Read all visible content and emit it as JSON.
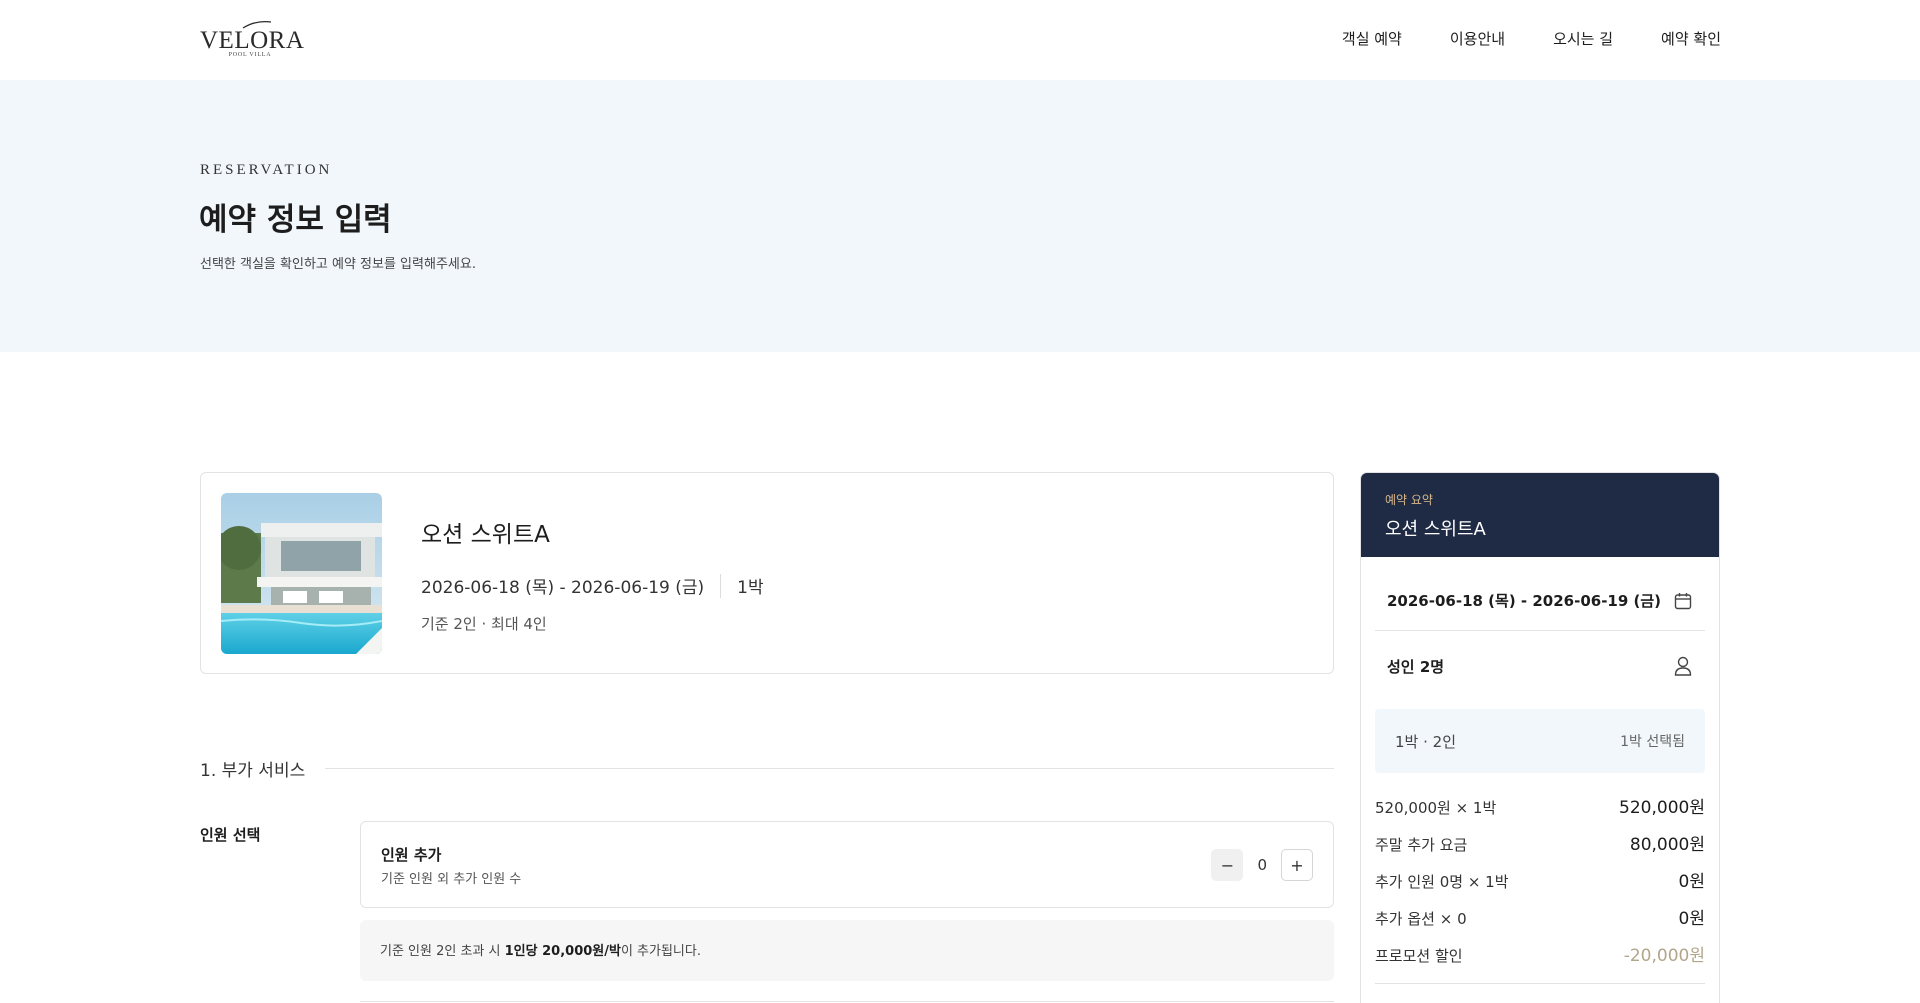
{
  "header": {
    "logo": {
      "name": "VELORA",
      "sub": "POOL VILLA"
    },
    "nav": [
      "객실 예약",
      "이용안내",
      "오시는 길",
      "예약 확인"
    ]
  },
  "hero": {
    "eyebrow": "RESERVATION",
    "title": "예약 정보 입력",
    "subtitle": "선택한 객실을 확인하고 예약 정보를 입력해주세요."
  },
  "room": {
    "name": "오션 스위트A",
    "dates": "2026-06-18 (목) - 2026-06-19 (금)",
    "nights": "1박",
    "capacity": "기준 2인 · 최대 4인"
  },
  "section": {
    "title": "1. 부가 서비스",
    "person_label": "인원 선택",
    "add_title": "인원 추가",
    "add_desc": "기준 인원 외 추가 인원 수",
    "count": "0",
    "minus": "−",
    "plus": "+",
    "note_prefix": "기준 인원 2인 초과 시 ",
    "note_bold": "1인당 20,000원/박",
    "note_suffix": "이 추가됩니다."
  },
  "summary": {
    "eyebrow": "예약 요약",
    "title": "오션 스위트A",
    "dates": "2026-06-18 (목) - 2026-06-19 (금)",
    "guests": "성인 2명",
    "pill_left": "1박 · 2인",
    "pill_right": "1박 선택됨",
    "rows": [
      {
        "label": "520,000원 × 1박",
        "value": "520,000원"
      },
      {
        "label": "주말 추가 요금",
        "value": "80,000원"
      },
      {
        "label": "추가 인원 0명 × 1박",
        "value": "0원"
      },
      {
        "label": "추가 옵션 × 0",
        "value": "0원"
      },
      {
        "label": "프로모션 할인",
        "value": "-20,000원"
      }
    ]
  },
  "colors": {
    "accent_navy": "#1f2a44",
    "gold": "#d9b88a",
    "discount": "#b2a68a",
    "hero_bg": "#f1f7fb"
  }
}
